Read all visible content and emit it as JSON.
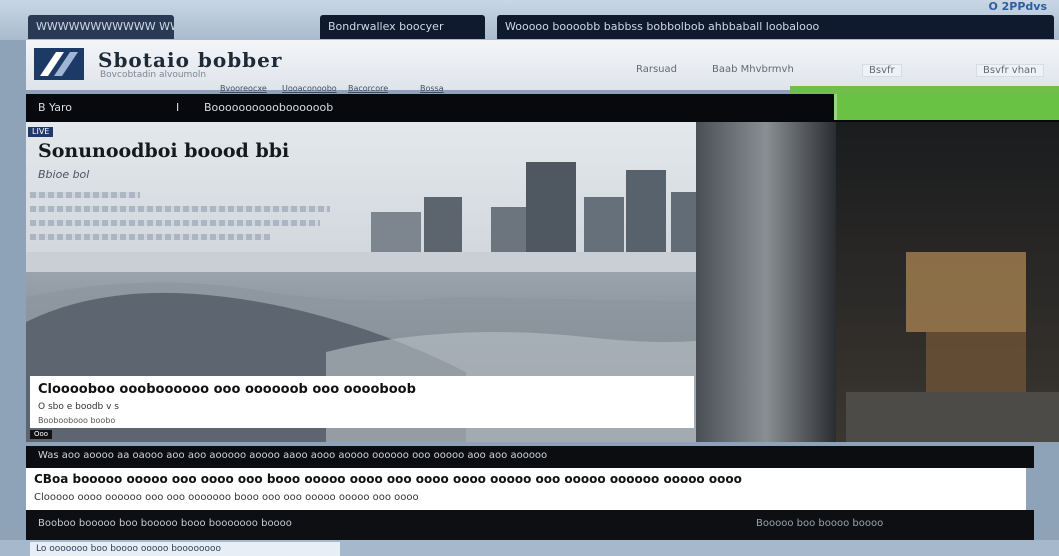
{
  "browser": {
    "tabs": [
      {
        "label": "WWWWWWWWWWW WWW"
      },
      {
        "label": "Bondrwallex boocyer"
      },
      {
        "label": "Wooooo boooobb babbss bobbolbob ahbbaball loobalooo"
      }
    ],
    "top_right": "O 2PPdvs"
  },
  "site": {
    "title": "Sbotaio bobber",
    "tagline": "Bovcobtadin alvoumoln",
    "header_links": [
      "Rarsuad",
      "Baab Mhvbrmvh",
      "Bsvfr",
      "Bsvfr vhan"
    ],
    "sub_links": [
      "Bvooreocxe",
      "Uooaconoobo",
      "Bacorcore",
      "Bossa"
    ]
  },
  "nav": {
    "items": [
      "B Yaro",
      "I",
      "Booooooooooboooooob"
    ]
  },
  "hero": {
    "badge": "LIVE",
    "title": "Sonunoodboi boood bbi",
    "subtitle": "Bbioe bol",
    "caption_title": "Clooooboo oooboooooo ooo oooooob ooo ooooboob",
    "caption_meta": "O sbo e boodb v s",
    "caption_small": "Booboobooo boobo",
    "corner_badge": "Ooo"
  },
  "article": {
    "bar_text": "Was aoo aoooo aa oaooo aoo aoo aooooo aoooo aaoo aooo aoooo oooooo ooo ooooo aoo aoo aooooo",
    "line1": "CBoa booooo ooooo ooo oooo ooo booo ooooo oooo ooo oooo oooo ooooo ooo ooooo oooooo ooooo oooo",
    "line2": "Clooooo oooo oooooo ooo ooo ooooooo booo ooo ooo ooooo ooooo ooo oooo",
    "footer_left": "Booboo booooo boo booooo booo booooooo boooo",
    "footer_right": "Booooo boo  boooo boooo"
  },
  "status": {
    "text": "Lo ooooooo boo boooo ooooo boooooooo"
  },
  "colors": {
    "accent_green": "#6ac245",
    "nav_bg": "#07090c",
    "brand_blue": "#1f3a6a"
  }
}
